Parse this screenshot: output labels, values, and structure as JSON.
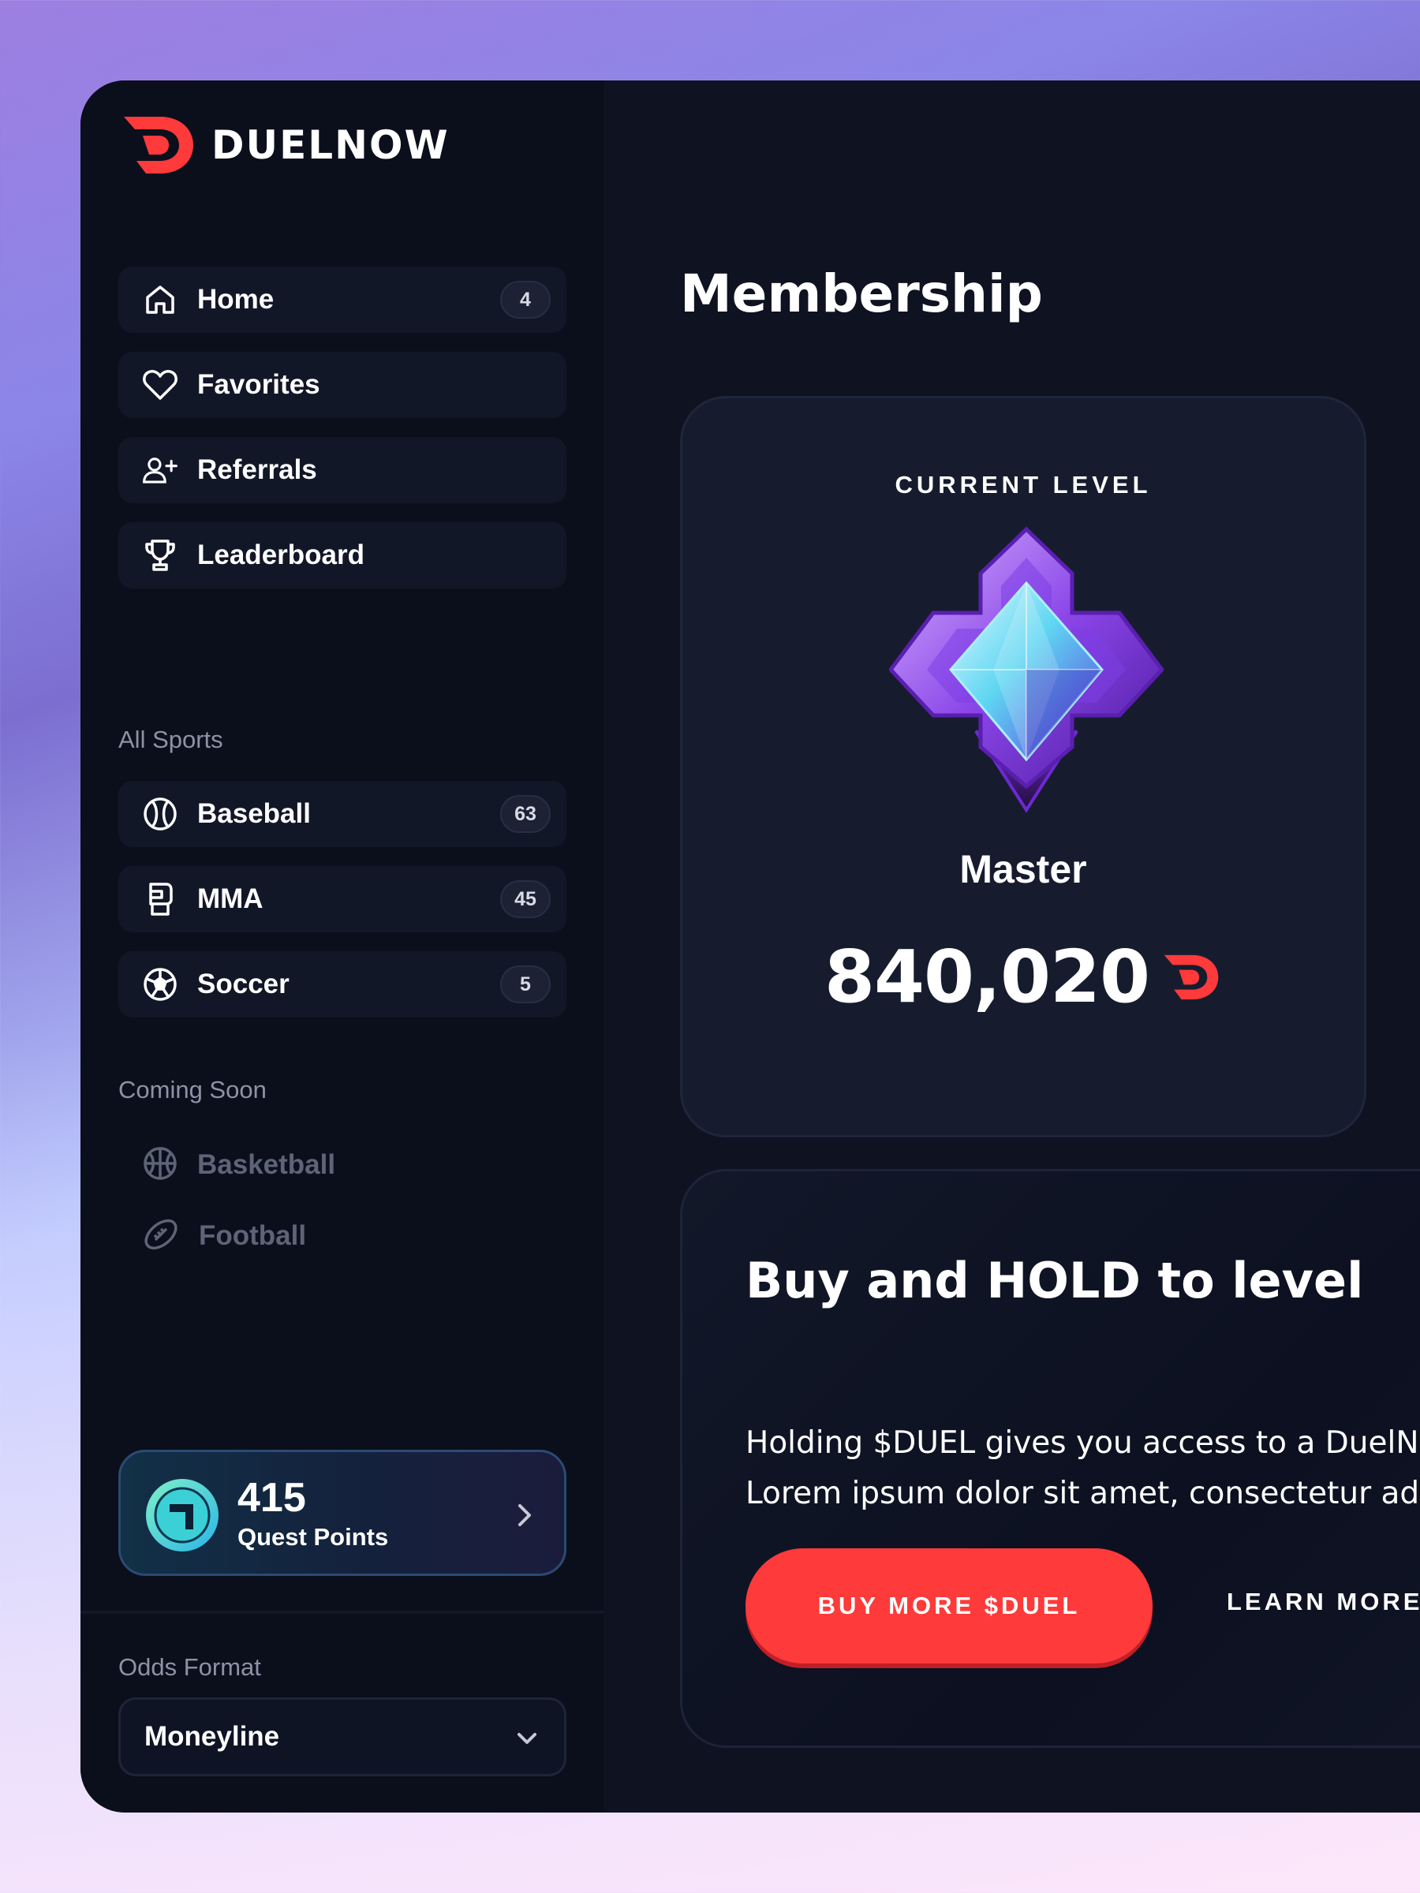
{
  "brand": {
    "name": "DUELNOW",
    "accent": "#ff3a3a"
  },
  "sidebar": {
    "nav": [
      {
        "label": "Home",
        "icon": "home-icon",
        "badge": "4"
      },
      {
        "label": "Favorites",
        "icon": "heart-icon"
      },
      {
        "label": "Referrals",
        "icon": "user-plus-icon"
      },
      {
        "label": "Leaderboard",
        "icon": "trophy-icon"
      }
    ],
    "sports_title": "All Sports",
    "sports": [
      {
        "label": "Baseball",
        "icon": "baseball-icon",
        "badge": "63"
      },
      {
        "label": "MMA",
        "icon": "boxing-glove-icon",
        "badge": "45"
      },
      {
        "label": "Soccer",
        "icon": "soccer-ball-icon",
        "badge": "5"
      }
    ],
    "coming_soon_title": "Coming Soon",
    "coming_soon": [
      {
        "label": "Basketball",
        "icon": "basketball-icon"
      },
      {
        "label": "Football",
        "icon": "football-icon"
      }
    ],
    "quest": {
      "value": "415",
      "label": "Quest Points"
    },
    "odds": {
      "label": "Odds Format",
      "value": "Moneyline"
    }
  },
  "main": {
    "title": "Membership",
    "level_card": {
      "kicker": "CURRENT LEVEL",
      "level": "Master",
      "balance": "840,020"
    },
    "promo": {
      "title": "Buy and HOLD to level",
      "line1": "Holding $DUEL gives you access to a DuelNov",
      "line2": "Lorem ipsum dolor sit amet, consectetur adipi",
      "primary_button": "BUY MORE $DUEL",
      "secondary_button": "LEARN MORE"
    }
  }
}
